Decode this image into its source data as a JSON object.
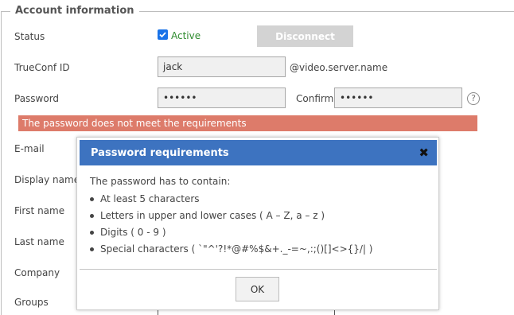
{
  "section": {
    "legend": "Account information"
  },
  "status": {
    "label": "Status",
    "checkbox_text": "Active",
    "disconnect_label": "Disconnect"
  },
  "trueconf_id": {
    "label": "TrueConf ID",
    "value": "jack",
    "suffix": "@video.server.name"
  },
  "password": {
    "label": "Password",
    "value": "••••••",
    "confirm_label": "Confirm",
    "confirm_value": "••••••",
    "help_icon": "?"
  },
  "error": {
    "text": "The password does not meet the requirements"
  },
  "labels": {
    "email": "E-mail",
    "display_name": "Display name",
    "first_name": "First name",
    "last_name": "Last name",
    "company": "Company",
    "groups": "Groups"
  },
  "modal": {
    "title": "Password requirements",
    "close": "✖",
    "intro": "The password has to contain:",
    "requirements": [
      "At least 5 characters",
      "Letters in upper and lower cases ( A – Z, a – z )",
      "Digits ( 0 - 9 )",
      "Special characters ( `\"^'?!*@#%$&+._-=~,:;()[]<>{}/| )"
    ],
    "ok_label": "OK"
  },
  "colors": {
    "modal_header": "#3d73c0",
    "error_bar": "#dd7b6a",
    "active_text": "#2e8b2e"
  }
}
